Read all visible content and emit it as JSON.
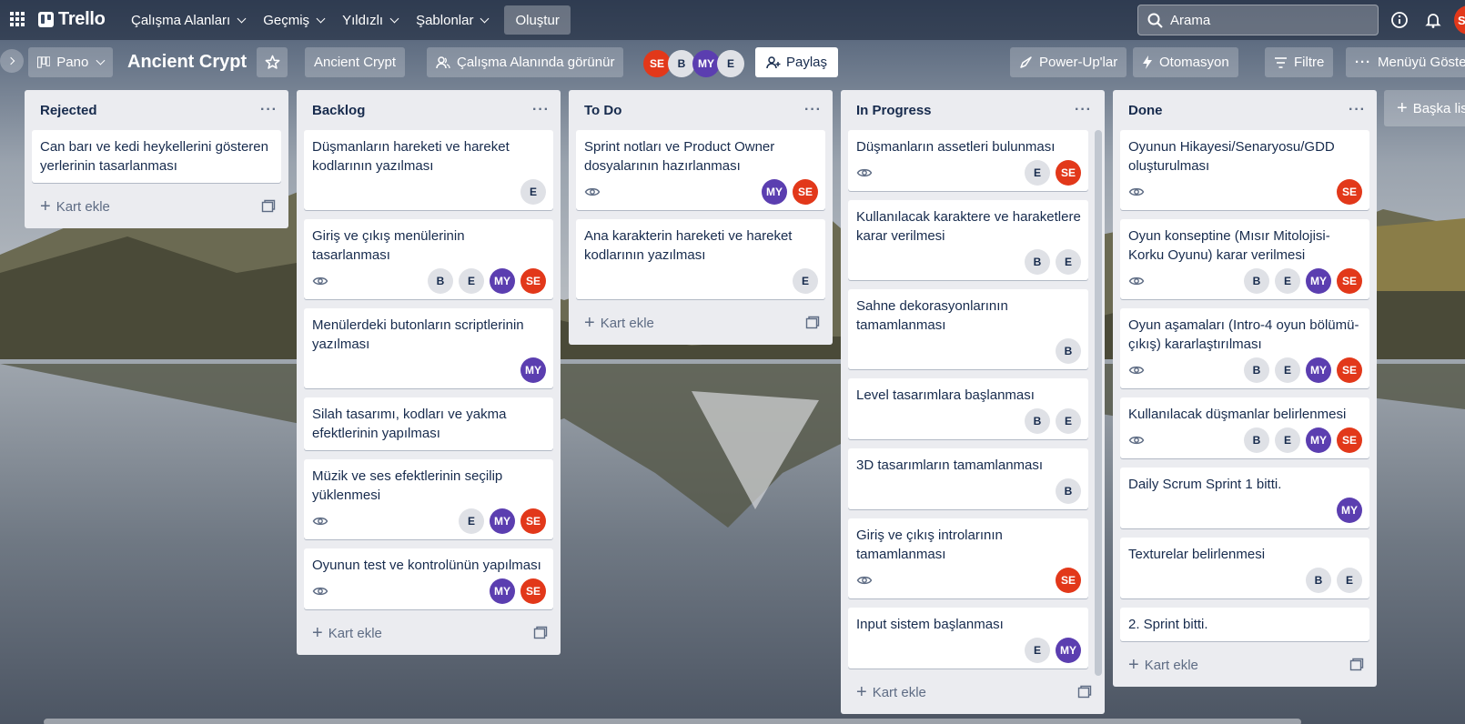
{
  "topnav": {
    "logo": "Trello",
    "menu": [
      "Çalışma Alanları",
      "Geçmiş",
      "Yıldızlı",
      "Şablonlar"
    ],
    "create": "Oluştur",
    "search_placeholder": "Arama",
    "user_initials": "S"
  },
  "boardbar": {
    "view": "Pano",
    "title": "Ancient Crypt",
    "workspace": "Ancient Crypt",
    "visibility": "Çalışma Alanında görünür",
    "members": [
      "SE",
      "B",
      "MY",
      "E"
    ],
    "share": "Paylaş",
    "powerups": "Power-Up'lar",
    "automation": "Otomasyon",
    "filter": "Filtre",
    "menu": "Menüyü Göster"
  },
  "add_card_label": "Kart ekle",
  "add_list_label": "Başka liste",
  "colors": {
    "SE": "#e2381a",
    "MY": "#5b3eb0",
    "grey": "#dfe1e6"
  },
  "lists": [
    {
      "title": "Rejected",
      "cards": [
        {
          "text": "Can barı ve kedi heykellerini gösteren yerlerinin tasarlanması",
          "watch": false,
          "members": []
        }
      ]
    },
    {
      "title": "Backlog",
      "cards": [
        {
          "text": "Düşmanların hareketi ve hareket kodlarının yazılması",
          "watch": false,
          "members": [
            "E"
          ]
        },
        {
          "text": "Giriş ve çıkış menülerinin tasarlanması",
          "watch": true,
          "members": [
            "B",
            "E",
            "MY",
            "SE"
          ]
        },
        {
          "text": "Menülerdeki butonların scriptlerinin yazılması",
          "watch": false,
          "members": [
            "MY"
          ]
        },
        {
          "text": "Silah tasarımı, kodları ve yakma efektlerinin yapılması",
          "watch": false,
          "members": []
        },
        {
          "text": "Müzik ve ses efektlerinin seçilip yüklenmesi",
          "watch": true,
          "members": [
            "E",
            "MY",
            "SE"
          ]
        },
        {
          "text": "Oyunun test ve kontrolünün yapılması",
          "watch": true,
          "members": [
            "MY",
            "SE"
          ]
        }
      ]
    },
    {
      "title": "To Do",
      "cards": [
        {
          "text": "Sprint notları ve Product Owner dosyalarının hazırlanması",
          "watch": true,
          "members": [
            "MY",
            "SE"
          ]
        },
        {
          "text": "Ana karakterin hareketi ve hareket kodlarının yazılması",
          "watch": false,
          "members": [
            "E"
          ]
        }
      ]
    },
    {
      "title": "In Progress",
      "cards": [
        {
          "text": "Düşmanların assetleri bulunması",
          "watch": true,
          "members": [
            "E",
            "SE"
          ]
        },
        {
          "text": "Kullanılacak karaktere ve haraketlere karar verilmesi",
          "watch": false,
          "members": [
            "B",
            "E"
          ]
        },
        {
          "text": "Sahne dekorasyonlarının tamamlanması",
          "watch": false,
          "members": [
            "B"
          ]
        },
        {
          "text": "Level tasarımlara başlanması",
          "watch": false,
          "members": [
            "B",
            "E"
          ]
        },
        {
          "text": "3D tasarımların tamamlanması",
          "watch": false,
          "members": [
            "B"
          ]
        },
        {
          "text": "Giriş ve çıkış introlarının tamamlanması",
          "watch": true,
          "members": [
            "SE"
          ]
        },
        {
          "text": "Input sistem başlanması",
          "watch": false,
          "members": [
            "E",
            "MY"
          ]
        }
      ]
    },
    {
      "title": "Done",
      "cards": [
        {
          "text": "Oyunun Hikayesi/Senaryosu/GDD oluşturulması",
          "watch": true,
          "members": [
            "SE"
          ]
        },
        {
          "text": "Oyun konseptine (Mısır Mitolojisi-Korku Oyunu) karar verilmesi",
          "watch": true,
          "members": [
            "B",
            "E",
            "MY",
            "SE"
          ]
        },
        {
          "text": "Oyun aşamaları (Intro-4 oyun bölümü-çıkış) kararlaştırılması",
          "watch": true,
          "members": [
            "B",
            "E",
            "MY",
            "SE"
          ]
        },
        {
          "text": "Kullanılacak düşmanlar belirlenmesi",
          "watch": true,
          "members": [
            "B",
            "E",
            "MY",
            "SE"
          ]
        },
        {
          "text": "Daily Scrum Sprint 1 bitti.",
          "watch": false,
          "members": [
            "MY"
          ]
        },
        {
          "text": "Texturelar belirlenmesi",
          "watch": false,
          "members": [
            "B",
            "E"
          ]
        },
        {
          "text": "2. Sprint bitti.",
          "watch": false,
          "members": []
        }
      ]
    }
  ]
}
